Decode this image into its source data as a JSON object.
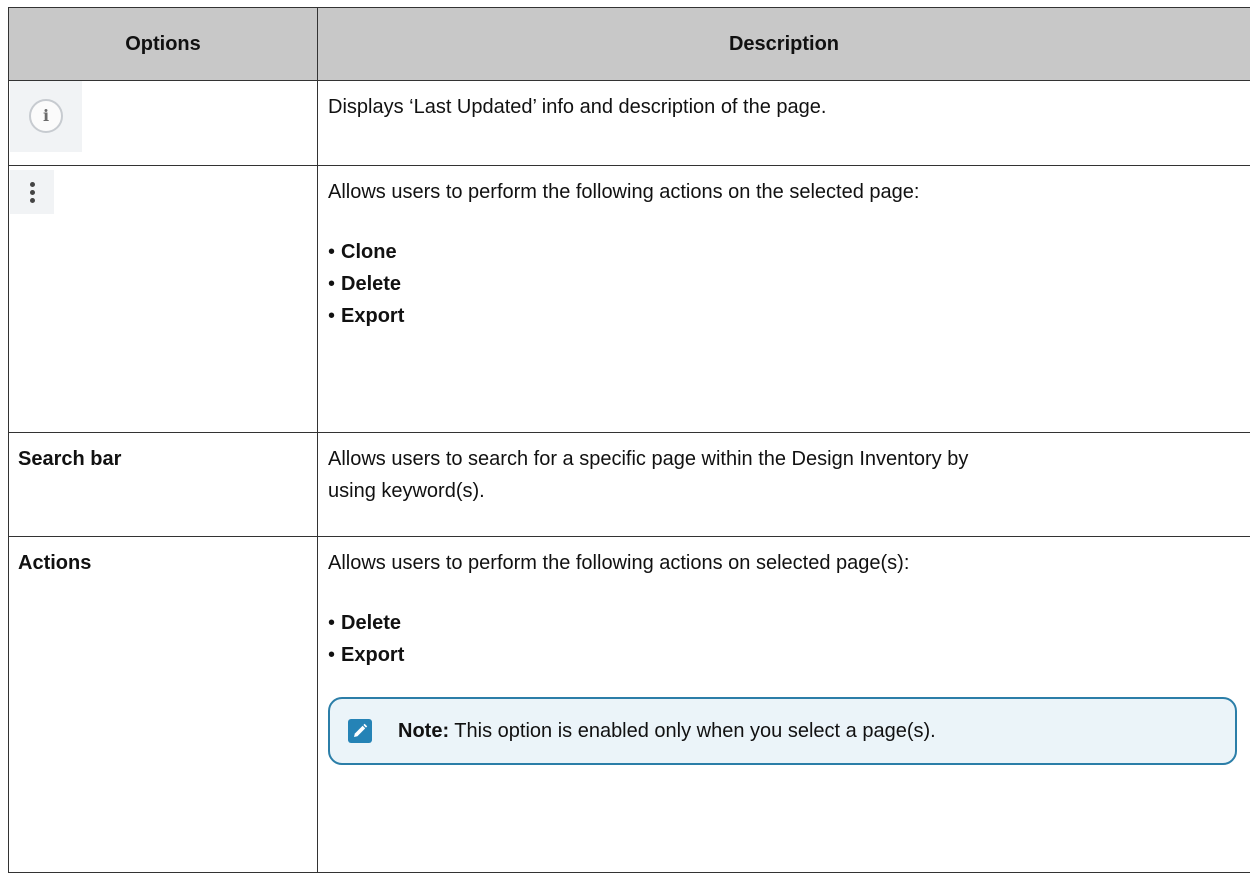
{
  "table": {
    "header": {
      "col1": "Options",
      "col2": "Description"
    },
    "rows": [
      {
        "icon": "info-icon",
        "description": "Displays ‘Last Updated’ info and description of the page."
      },
      {
        "icon": "kebab-menu-icon",
        "description": "Allows users to perform the following actions on the selected page:",
        "bullets": [
          "Clone",
          "Delete",
          "Export"
        ]
      },
      {
        "option": "Search bar",
        "description_lines": [
          "Allows users to search for a specific page within the Design Inventory by",
          "using keyword(s)."
        ]
      },
      {
        "option": "Actions",
        "description": "Allows users to perform the following actions on selected page(s):",
        "bullets": [
          "Delete",
          "Export"
        ],
        "note": {
          "label": "Note:",
          "text": " This option is enabled only when you select a page(s)."
        }
      }
    ]
  },
  "colors": {
    "header_bg": "#c8c8c8",
    "note_border": "#2b7ea8",
    "note_bg": "#ebf4f9",
    "note_icon": "#2583b6"
  }
}
